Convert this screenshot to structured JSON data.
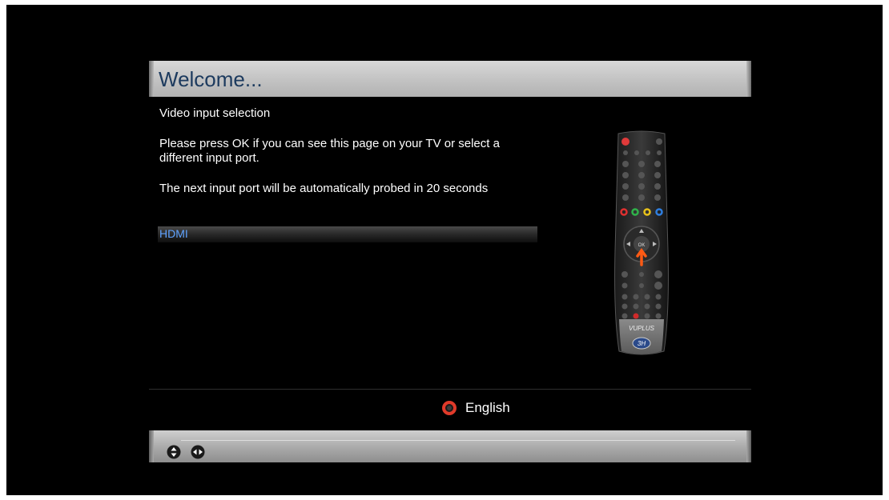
{
  "header": {
    "title": "Welcome..."
  },
  "content": {
    "heading": "Video input selection",
    "instruction": "Please press OK if you can see this page on your TV or select a different input port.",
    "timer_text": "The next input port will be automatically probed in 20 seconds"
  },
  "input_list": {
    "items": [
      {
        "label": "HDMI",
        "selected": true
      }
    ]
  },
  "remote": {
    "brand": "VUPLUS",
    "ok_label": "OK",
    "color_keys": [
      "#e03030",
      "#2fb34a",
      "#e8c21a",
      "#2f7fe0"
    ]
  },
  "footer": {
    "language_label": "English",
    "language_icon_color": "#e03a2a"
  },
  "nav_icons": [
    "up-down-arrows-icon",
    "left-right-arrows-icon"
  ]
}
